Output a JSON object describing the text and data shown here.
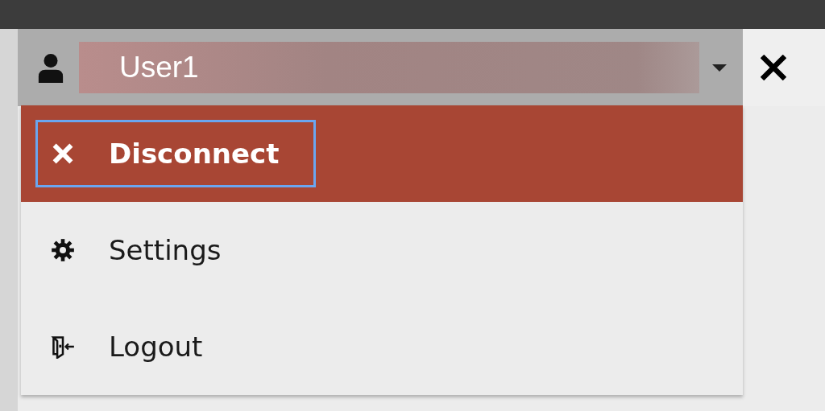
{
  "user_menu": {
    "user_name": "User1",
    "items": [
      {
        "kind": "disconnect",
        "label": "Disconnect",
        "selected": true
      },
      {
        "kind": "settings",
        "label": "Settings",
        "selected": false
      },
      {
        "kind": "logout",
        "label": "Logout",
        "selected": false
      }
    ]
  }
}
